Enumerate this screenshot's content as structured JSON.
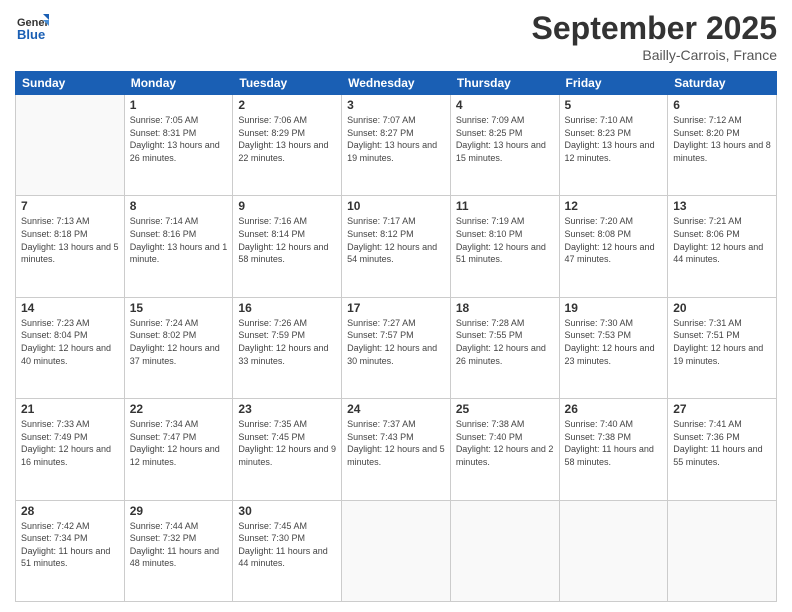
{
  "header": {
    "logo": {
      "general": "General",
      "blue": "Blue"
    },
    "title": "September 2025",
    "location": "Bailly-Carrois, France"
  },
  "weekdays": [
    "Sunday",
    "Monday",
    "Tuesday",
    "Wednesday",
    "Thursday",
    "Friday",
    "Saturday"
  ],
  "weeks": [
    [
      {
        "day": "",
        "sunrise": "",
        "sunset": "",
        "daylight": ""
      },
      {
        "day": "1",
        "sunrise": "Sunrise: 7:05 AM",
        "sunset": "Sunset: 8:31 PM",
        "daylight": "Daylight: 13 hours and 26 minutes."
      },
      {
        "day": "2",
        "sunrise": "Sunrise: 7:06 AM",
        "sunset": "Sunset: 8:29 PM",
        "daylight": "Daylight: 13 hours and 22 minutes."
      },
      {
        "day": "3",
        "sunrise": "Sunrise: 7:07 AM",
        "sunset": "Sunset: 8:27 PM",
        "daylight": "Daylight: 13 hours and 19 minutes."
      },
      {
        "day": "4",
        "sunrise": "Sunrise: 7:09 AM",
        "sunset": "Sunset: 8:25 PM",
        "daylight": "Daylight: 13 hours and 15 minutes."
      },
      {
        "day": "5",
        "sunrise": "Sunrise: 7:10 AM",
        "sunset": "Sunset: 8:23 PM",
        "daylight": "Daylight: 13 hours and 12 minutes."
      },
      {
        "day": "6",
        "sunrise": "Sunrise: 7:12 AM",
        "sunset": "Sunset: 8:20 PM",
        "daylight": "Daylight: 13 hours and 8 minutes."
      }
    ],
    [
      {
        "day": "7",
        "sunrise": "Sunrise: 7:13 AM",
        "sunset": "Sunset: 8:18 PM",
        "daylight": "Daylight: 13 hours and 5 minutes."
      },
      {
        "day": "8",
        "sunrise": "Sunrise: 7:14 AM",
        "sunset": "Sunset: 8:16 PM",
        "daylight": "Daylight: 13 hours and 1 minute."
      },
      {
        "day": "9",
        "sunrise": "Sunrise: 7:16 AM",
        "sunset": "Sunset: 8:14 PM",
        "daylight": "Daylight: 12 hours and 58 minutes."
      },
      {
        "day": "10",
        "sunrise": "Sunrise: 7:17 AM",
        "sunset": "Sunset: 8:12 PM",
        "daylight": "Daylight: 12 hours and 54 minutes."
      },
      {
        "day": "11",
        "sunrise": "Sunrise: 7:19 AM",
        "sunset": "Sunset: 8:10 PM",
        "daylight": "Daylight: 12 hours and 51 minutes."
      },
      {
        "day": "12",
        "sunrise": "Sunrise: 7:20 AM",
        "sunset": "Sunset: 8:08 PM",
        "daylight": "Daylight: 12 hours and 47 minutes."
      },
      {
        "day": "13",
        "sunrise": "Sunrise: 7:21 AM",
        "sunset": "Sunset: 8:06 PM",
        "daylight": "Daylight: 12 hours and 44 minutes."
      }
    ],
    [
      {
        "day": "14",
        "sunrise": "Sunrise: 7:23 AM",
        "sunset": "Sunset: 8:04 PM",
        "daylight": "Daylight: 12 hours and 40 minutes."
      },
      {
        "day": "15",
        "sunrise": "Sunrise: 7:24 AM",
        "sunset": "Sunset: 8:02 PM",
        "daylight": "Daylight: 12 hours and 37 minutes."
      },
      {
        "day": "16",
        "sunrise": "Sunrise: 7:26 AM",
        "sunset": "Sunset: 7:59 PM",
        "daylight": "Daylight: 12 hours and 33 minutes."
      },
      {
        "day": "17",
        "sunrise": "Sunrise: 7:27 AM",
        "sunset": "Sunset: 7:57 PM",
        "daylight": "Daylight: 12 hours and 30 minutes."
      },
      {
        "day": "18",
        "sunrise": "Sunrise: 7:28 AM",
        "sunset": "Sunset: 7:55 PM",
        "daylight": "Daylight: 12 hours and 26 minutes."
      },
      {
        "day": "19",
        "sunrise": "Sunrise: 7:30 AM",
        "sunset": "Sunset: 7:53 PM",
        "daylight": "Daylight: 12 hours and 23 minutes."
      },
      {
        "day": "20",
        "sunrise": "Sunrise: 7:31 AM",
        "sunset": "Sunset: 7:51 PM",
        "daylight": "Daylight: 12 hours and 19 minutes."
      }
    ],
    [
      {
        "day": "21",
        "sunrise": "Sunrise: 7:33 AM",
        "sunset": "Sunset: 7:49 PM",
        "daylight": "Daylight: 12 hours and 16 minutes."
      },
      {
        "day": "22",
        "sunrise": "Sunrise: 7:34 AM",
        "sunset": "Sunset: 7:47 PM",
        "daylight": "Daylight: 12 hours and 12 minutes."
      },
      {
        "day": "23",
        "sunrise": "Sunrise: 7:35 AM",
        "sunset": "Sunset: 7:45 PM",
        "daylight": "Daylight: 12 hours and 9 minutes."
      },
      {
        "day": "24",
        "sunrise": "Sunrise: 7:37 AM",
        "sunset": "Sunset: 7:43 PM",
        "daylight": "Daylight: 12 hours and 5 minutes."
      },
      {
        "day": "25",
        "sunrise": "Sunrise: 7:38 AM",
        "sunset": "Sunset: 7:40 PM",
        "daylight": "Daylight: 12 hours and 2 minutes."
      },
      {
        "day": "26",
        "sunrise": "Sunrise: 7:40 AM",
        "sunset": "Sunset: 7:38 PM",
        "daylight": "Daylight: 11 hours and 58 minutes."
      },
      {
        "day": "27",
        "sunrise": "Sunrise: 7:41 AM",
        "sunset": "Sunset: 7:36 PM",
        "daylight": "Daylight: 11 hours and 55 minutes."
      }
    ],
    [
      {
        "day": "28",
        "sunrise": "Sunrise: 7:42 AM",
        "sunset": "Sunset: 7:34 PM",
        "daylight": "Daylight: 11 hours and 51 minutes."
      },
      {
        "day": "29",
        "sunrise": "Sunrise: 7:44 AM",
        "sunset": "Sunset: 7:32 PM",
        "daylight": "Daylight: 11 hours and 48 minutes."
      },
      {
        "day": "30",
        "sunrise": "Sunrise: 7:45 AM",
        "sunset": "Sunset: 7:30 PM",
        "daylight": "Daylight: 11 hours and 44 minutes."
      },
      {
        "day": "",
        "sunrise": "",
        "sunset": "",
        "daylight": ""
      },
      {
        "day": "",
        "sunrise": "",
        "sunset": "",
        "daylight": ""
      },
      {
        "day": "",
        "sunrise": "",
        "sunset": "",
        "daylight": ""
      },
      {
        "day": "",
        "sunrise": "",
        "sunset": "",
        "daylight": ""
      }
    ]
  ]
}
